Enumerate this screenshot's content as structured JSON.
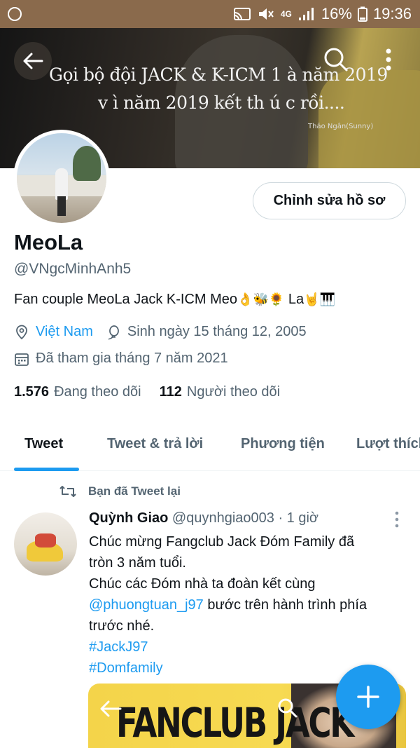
{
  "status_bar": {
    "network": "4G",
    "battery": "16%",
    "time": "19:36"
  },
  "banner": {
    "line1": "Gọi bộ đội JACK & K-ICM 1 à  năm 2019",
    "line2": "v ì năm 2019 kết th ú c rồi....",
    "signature": "Thảo Ngân(Sunny)"
  },
  "profile": {
    "edit_label": "Chỉnh sửa hồ sơ",
    "display_name": "MeoLa",
    "handle": "@VNgcMinhAnh5",
    "bio_text": "Fan couple MeoLa  Jack K-ICM Meo",
    "bio_emoji_1": "👌🐝🌻",
    "bio_la": " La",
    "bio_emoji_2": "🤘🎹",
    "location": "Việt Nam",
    "birthday": "Sinh ngày 15 tháng 12, 2005",
    "joined": "Đã tham gia tháng 7 năm 2021",
    "following_count": "1.576",
    "following_label": "Đang theo dõi",
    "followers_count": "112",
    "followers_label": "Người theo dõi"
  },
  "tabs": [
    {
      "label": "Tweet",
      "active": true
    },
    {
      "label": "Tweet & trả lời",
      "active": false
    },
    {
      "label": "Phương tiện",
      "active": false
    },
    {
      "label": "Lượt thích",
      "active": false
    }
  ],
  "tweet": {
    "retweet_label": "Bạn đã Tweet lại",
    "author_name": "Quỳnh Giao",
    "author_handle": "@quynhgiao003",
    "time": " · 1 giờ",
    "line1": "Chúc mừng Fangclub Jack Đóm Family đã",
    "line2": "tròn 3 năm tuổi.",
    "line3": "Chúc các Đóm nhà ta đoàn kết cùng",
    "mention": "@phuongtuan_j97",
    "line4_rest": " bước trên hành trình phía",
    "line5": "trước nhé.",
    "hashtag1": "#JackJ97",
    "hashtag2": "#Domfamily",
    "media_title": "FANCLUB JACK"
  },
  "colors": {
    "accent": "#1d9bf0",
    "text_primary": "#0f1419",
    "text_secondary": "#536471"
  }
}
